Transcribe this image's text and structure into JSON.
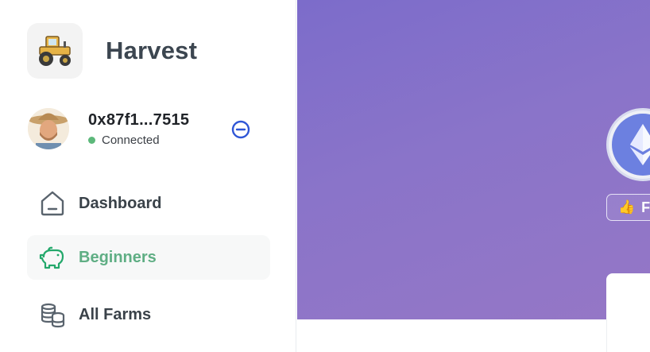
{
  "brand": {
    "name": "Harvest",
    "logo_icon": "tractor-icon"
  },
  "wallet": {
    "address": "0x87f1...7515",
    "status": "Connected",
    "status_color": "#5cb87a",
    "avatar": "farmer-avatar",
    "disconnect_icon": "disconnect-icon"
  },
  "nav": {
    "items": [
      {
        "label": "Dashboard",
        "icon": "home-icon",
        "active": false
      },
      {
        "label": "Beginners",
        "icon": "piggy-bank-icon",
        "active": true
      },
      {
        "label": "All Farms",
        "icon": "coin-stack-icon",
        "active": false
      }
    ]
  },
  "main": {
    "token_icon": "ethereum-icon",
    "tag_icon": "thumbs-up-icon",
    "tag_text": "F",
    "background_start": "#7c6cca",
    "background_end": "#9577c6"
  },
  "colors": {
    "accent": "#5fae84",
    "text_dark": "#3a4249",
    "disconnect_blue": "#2f56d6"
  }
}
